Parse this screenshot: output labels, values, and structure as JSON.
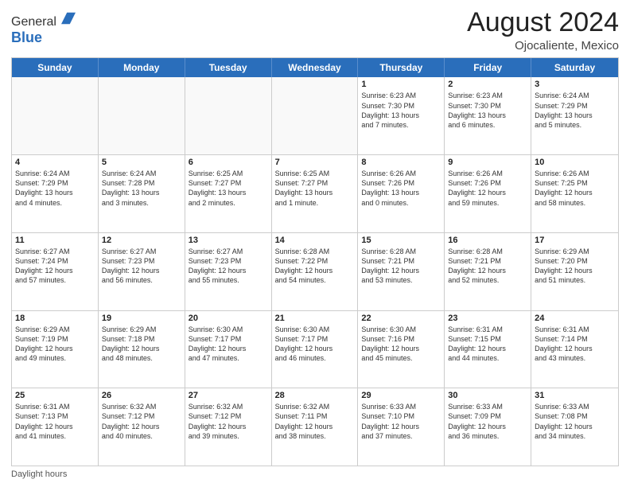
{
  "header": {
    "logo_general": "General",
    "logo_blue": "Blue",
    "month_year": "August 2024",
    "location": "Ojocaliente, Mexico"
  },
  "days_of_week": [
    "Sunday",
    "Monday",
    "Tuesday",
    "Wednesday",
    "Thursday",
    "Friday",
    "Saturday"
  ],
  "footer": {
    "note": "Daylight hours"
  },
  "weeks": [
    {
      "cells": [
        {
          "day": "",
          "info": "",
          "empty": true
        },
        {
          "day": "",
          "info": "",
          "empty": true
        },
        {
          "day": "",
          "info": "",
          "empty": true
        },
        {
          "day": "",
          "info": "",
          "empty": true
        },
        {
          "day": "1",
          "info": "Sunrise: 6:23 AM\nSunset: 7:30 PM\nDaylight: 13 hours\nand 7 minutes.",
          "empty": false
        },
        {
          "day": "2",
          "info": "Sunrise: 6:23 AM\nSunset: 7:30 PM\nDaylight: 13 hours\nand 6 minutes.",
          "empty": false
        },
        {
          "day": "3",
          "info": "Sunrise: 6:24 AM\nSunset: 7:29 PM\nDaylight: 13 hours\nand 5 minutes.",
          "empty": false
        }
      ]
    },
    {
      "cells": [
        {
          "day": "4",
          "info": "Sunrise: 6:24 AM\nSunset: 7:29 PM\nDaylight: 13 hours\nand 4 minutes.",
          "empty": false
        },
        {
          "day": "5",
          "info": "Sunrise: 6:24 AM\nSunset: 7:28 PM\nDaylight: 13 hours\nand 3 minutes.",
          "empty": false
        },
        {
          "day": "6",
          "info": "Sunrise: 6:25 AM\nSunset: 7:27 PM\nDaylight: 13 hours\nand 2 minutes.",
          "empty": false
        },
        {
          "day": "7",
          "info": "Sunrise: 6:25 AM\nSunset: 7:27 PM\nDaylight: 13 hours\nand 1 minute.",
          "empty": false
        },
        {
          "day": "8",
          "info": "Sunrise: 6:26 AM\nSunset: 7:26 PM\nDaylight: 13 hours\nand 0 minutes.",
          "empty": false
        },
        {
          "day": "9",
          "info": "Sunrise: 6:26 AM\nSunset: 7:26 PM\nDaylight: 12 hours\nand 59 minutes.",
          "empty": false
        },
        {
          "day": "10",
          "info": "Sunrise: 6:26 AM\nSunset: 7:25 PM\nDaylight: 12 hours\nand 58 minutes.",
          "empty": false
        }
      ]
    },
    {
      "cells": [
        {
          "day": "11",
          "info": "Sunrise: 6:27 AM\nSunset: 7:24 PM\nDaylight: 12 hours\nand 57 minutes.",
          "empty": false
        },
        {
          "day": "12",
          "info": "Sunrise: 6:27 AM\nSunset: 7:23 PM\nDaylight: 12 hours\nand 56 minutes.",
          "empty": false
        },
        {
          "day": "13",
          "info": "Sunrise: 6:27 AM\nSunset: 7:23 PM\nDaylight: 12 hours\nand 55 minutes.",
          "empty": false
        },
        {
          "day": "14",
          "info": "Sunrise: 6:28 AM\nSunset: 7:22 PM\nDaylight: 12 hours\nand 54 minutes.",
          "empty": false
        },
        {
          "day": "15",
          "info": "Sunrise: 6:28 AM\nSunset: 7:21 PM\nDaylight: 12 hours\nand 53 minutes.",
          "empty": false
        },
        {
          "day": "16",
          "info": "Sunrise: 6:28 AM\nSunset: 7:21 PM\nDaylight: 12 hours\nand 52 minutes.",
          "empty": false
        },
        {
          "day": "17",
          "info": "Sunrise: 6:29 AM\nSunset: 7:20 PM\nDaylight: 12 hours\nand 51 minutes.",
          "empty": false
        }
      ]
    },
    {
      "cells": [
        {
          "day": "18",
          "info": "Sunrise: 6:29 AM\nSunset: 7:19 PM\nDaylight: 12 hours\nand 49 minutes.",
          "empty": false
        },
        {
          "day": "19",
          "info": "Sunrise: 6:29 AM\nSunset: 7:18 PM\nDaylight: 12 hours\nand 48 minutes.",
          "empty": false
        },
        {
          "day": "20",
          "info": "Sunrise: 6:30 AM\nSunset: 7:17 PM\nDaylight: 12 hours\nand 47 minutes.",
          "empty": false
        },
        {
          "day": "21",
          "info": "Sunrise: 6:30 AM\nSunset: 7:17 PM\nDaylight: 12 hours\nand 46 minutes.",
          "empty": false
        },
        {
          "day": "22",
          "info": "Sunrise: 6:30 AM\nSunset: 7:16 PM\nDaylight: 12 hours\nand 45 minutes.",
          "empty": false
        },
        {
          "day": "23",
          "info": "Sunrise: 6:31 AM\nSunset: 7:15 PM\nDaylight: 12 hours\nand 44 minutes.",
          "empty": false
        },
        {
          "day": "24",
          "info": "Sunrise: 6:31 AM\nSunset: 7:14 PM\nDaylight: 12 hours\nand 43 minutes.",
          "empty": false
        }
      ]
    },
    {
      "cells": [
        {
          "day": "25",
          "info": "Sunrise: 6:31 AM\nSunset: 7:13 PM\nDaylight: 12 hours\nand 41 minutes.",
          "empty": false
        },
        {
          "day": "26",
          "info": "Sunrise: 6:32 AM\nSunset: 7:12 PM\nDaylight: 12 hours\nand 40 minutes.",
          "empty": false
        },
        {
          "day": "27",
          "info": "Sunrise: 6:32 AM\nSunset: 7:12 PM\nDaylight: 12 hours\nand 39 minutes.",
          "empty": false
        },
        {
          "day": "28",
          "info": "Sunrise: 6:32 AM\nSunset: 7:11 PM\nDaylight: 12 hours\nand 38 minutes.",
          "empty": false
        },
        {
          "day": "29",
          "info": "Sunrise: 6:33 AM\nSunset: 7:10 PM\nDaylight: 12 hours\nand 37 minutes.",
          "empty": false
        },
        {
          "day": "30",
          "info": "Sunrise: 6:33 AM\nSunset: 7:09 PM\nDaylight: 12 hours\nand 36 minutes.",
          "empty": false
        },
        {
          "day": "31",
          "info": "Sunrise: 6:33 AM\nSunset: 7:08 PM\nDaylight: 12 hours\nand 34 minutes.",
          "empty": false
        }
      ]
    }
  ]
}
